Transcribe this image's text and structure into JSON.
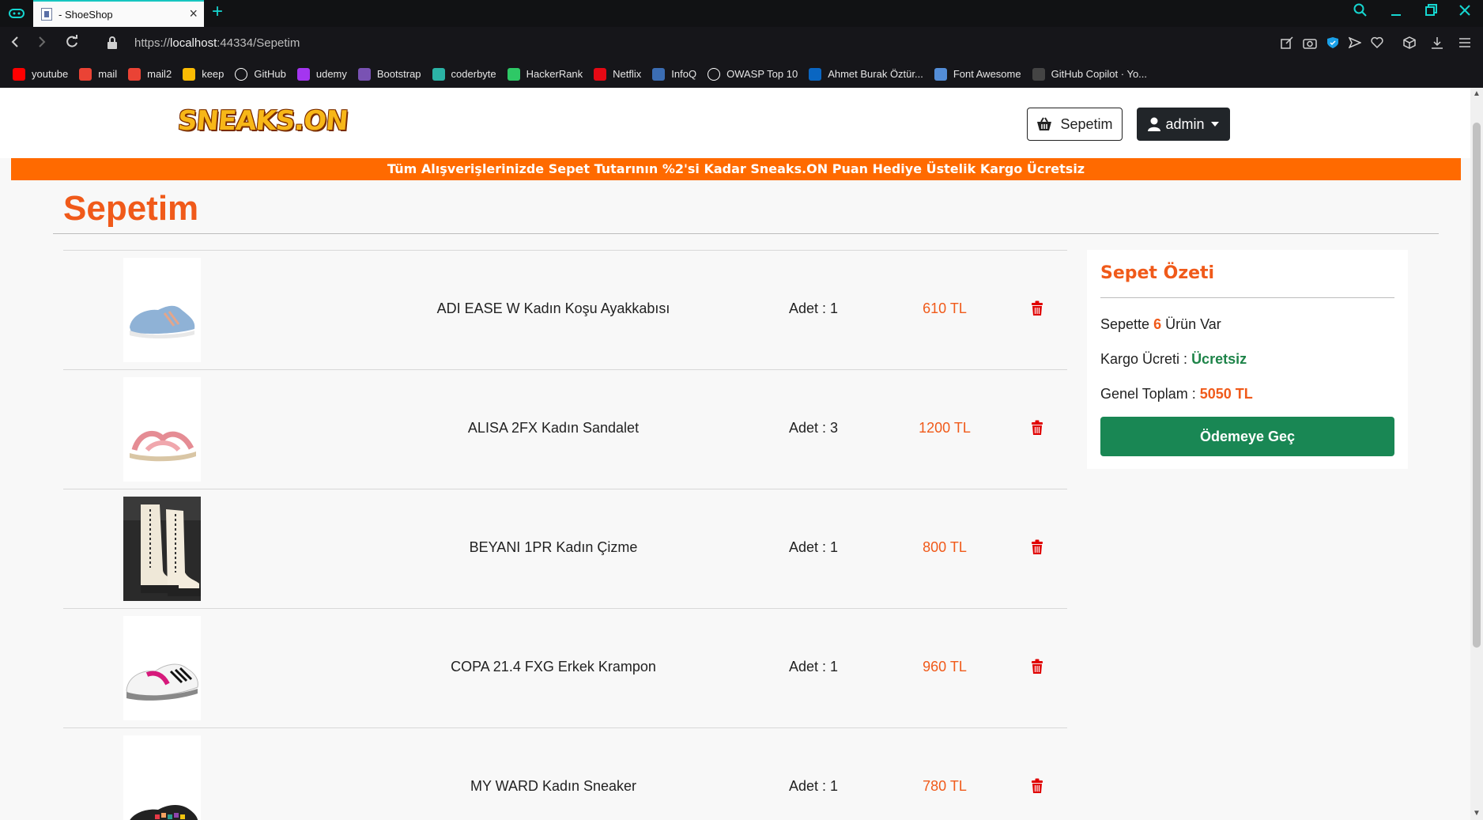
{
  "browser": {
    "tab_title": "- ShoeShop",
    "url_prefix": "https://",
    "url_host": "localhost",
    "url_rest": ":44334/Sepetim",
    "bookmarks": [
      {
        "label": "youtube",
        "icon": "youtube-icon",
        "color": "#ff0000"
      },
      {
        "label": "mail",
        "icon": "gmail-icon",
        "color": "#ea4335"
      },
      {
        "label": "mail2",
        "icon": "gmail-icon",
        "color": "#ea4335"
      },
      {
        "label": "keep",
        "icon": "keep-icon",
        "color": "#fbbc04"
      },
      {
        "label": "GitHub",
        "icon": "github-icon",
        "color": "#ffffff"
      },
      {
        "label": "udemy",
        "icon": "udemy-icon",
        "color": "#a435f0"
      },
      {
        "label": "Bootstrap",
        "icon": "bootstrap-icon",
        "color": "#7952b3"
      },
      {
        "label": "coderbyte",
        "icon": "coderbyte-icon",
        "color": "#2bb3a6"
      },
      {
        "label": "HackerRank",
        "icon": "hackerrank-icon",
        "color": "#2ec866"
      },
      {
        "label": "Netflix",
        "icon": "netflix-icon",
        "color": "#e50914"
      },
      {
        "label": "InfoQ",
        "icon": "infoq-icon",
        "color": "#3b6db3"
      },
      {
        "label": "OWASP Top 10",
        "icon": "owasp-icon",
        "color": "#ffffff"
      },
      {
        "label": "Ahmet Burak Öztür...",
        "icon": "linkedin-icon",
        "color": "#0a66c2"
      },
      {
        "label": "Font Awesome",
        "icon": "fontawesome-icon",
        "color": "#538dd7"
      },
      {
        "label": "GitHub Copilot · Yo...",
        "icon": "github-icon",
        "color": "#444444"
      }
    ]
  },
  "header": {
    "logo_text": "SNEAKS.ON",
    "cart_button": "Sepetim",
    "user_button": "admin"
  },
  "promo": "Tüm Alışverişlerinizde Sepet Tutarının %2'si Kadar Sneaks.ON Puan Hediye Üstelik Kargo Ücretsiz",
  "page_title": "Sepetim",
  "cart": {
    "items": [
      {
        "name": "ADI EASE W Kadın Koşu Ayakkabısı",
        "qty": "Adet : 1",
        "price": "610 TL"
      },
      {
        "name": "ALISA 2FX Kadın Sandalet",
        "qty": "Adet : 3",
        "price": "1200 TL"
      },
      {
        "name": "BEYANI 1PR Kadın Çizme",
        "qty": "Adet : 1",
        "price": "800 TL"
      },
      {
        "name": "COPA 21.4 FXG Erkek Krampon",
        "qty": "Adet : 1",
        "price": "960 TL"
      },
      {
        "name": "MY WARD Kadın Sneaker",
        "qty": "Adet : 1",
        "price": "780 TL"
      }
    ]
  },
  "summary": {
    "title": "Sepet Özeti",
    "count_prefix": "Sepette",
    "count_value": "6",
    "count_suffix": "Ürün Var",
    "shipping_label": "Kargo Ücreti :",
    "shipping_value": "Ücretsiz",
    "total_label": "Genel Toplam :",
    "total_value": "5050 TL",
    "checkout_button": "Ödemeye Geç"
  },
  "colors": {
    "accent": "#f05a1a",
    "promo_bg": "#ff6a00",
    "success": "#198754",
    "danger": "#e00000"
  }
}
